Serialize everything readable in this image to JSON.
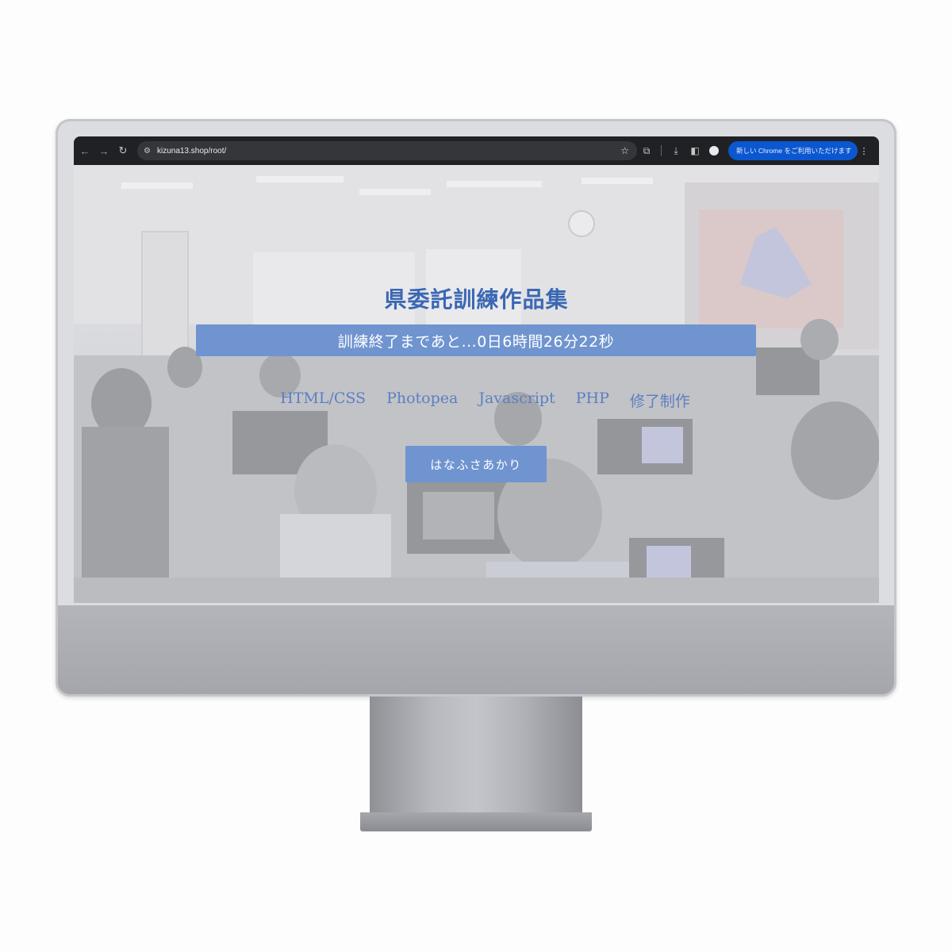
{
  "browser": {
    "url": "kizuna13.shop/root/",
    "update_label": "新しい Chrome をご利用いただけます",
    "icons": {
      "back": "arrow-left",
      "forward": "arrow-right",
      "reload": "reload",
      "site_info": "tune",
      "bookmark": "star",
      "extensions": "puzzle",
      "downloads": "download",
      "side_panel": "side-panel",
      "profile": "person",
      "menu": "kebab"
    }
  },
  "page": {
    "title": "県委託訓練作品集",
    "countdown": "訓練終了まであと...0日6時間26分22秒",
    "nav": [
      {
        "label": "HTML/CSS"
      },
      {
        "label": "Photopea"
      },
      {
        "label": "Javascript"
      },
      {
        "label": "PHP"
      },
      {
        "label": "修了制作"
      }
    ],
    "author_button": "はなふさあかり"
  },
  "colors": {
    "accent": "#6f94cf",
    "title": "#3b68b3",
    "nav_link": "#5d7fc2",
    "browser_chrome": "#202124",
    "update_pill": "#0b57d0"
  }
}
